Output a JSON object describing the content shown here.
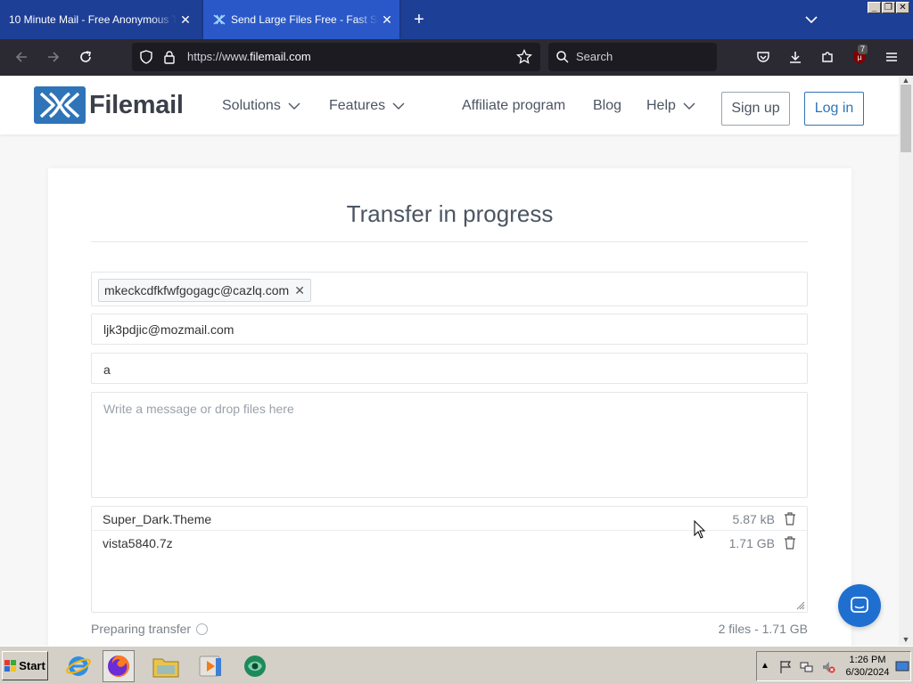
{
  "browser": {
    "tabs": [
      {
        "title": "10 Minute Mail - Free Anonymous Temporary email",
        "active": false
      },
      {
        "title": "Send Large Files Free - Fast Secure File Transfer",
        "active": true
      }
    ],
    "url_prefix": "https://www.",
    "url_host": "filemail.com",
    "search_placeholder": "Search",
    "extension_badge": "7"
  },
  "site": {
    "logo_text": "Filemail",
    "nav": {
      "solutions": "Solutions",
      "features": "Features",
      "affiliate": "Affiliate program",
      "blog": "Blog",
      "help": "Help"
    },
    "signup_label": "Sign up",
    "login_label": "Log in"
  },
  "transfer": {
    "title": "Transfer in progress",
    "recipient_chip": "mkeckcdfkfwfgogagc@cazlq.com",
    "sender_email": "ljk3pdjic@mozmail.com",
    "subject": "a",
    "message_placeholder": "Write a message or drop files here",
    "files": [
      {
        "name": "Super_Dark.Theme",
        "size": "5.87 kB"
      },
      {
        "name": "vista5840.7z",
        "size": "1.71 GB"
      }
    ],
    "status": "Preparing transfer",
    "summary": "2 files - 1.71 GB"
  },
  "taskbar": {
    "start_label": "Start",
    "time": "1:26 PM",
    "date": "6/30/2024"
  },
  "colors": {
    "brand_blue": "#2f74b8",
    "tab_strip": "#1e3f96",
    "chat_button": "#1f6fd1"
  }
}
